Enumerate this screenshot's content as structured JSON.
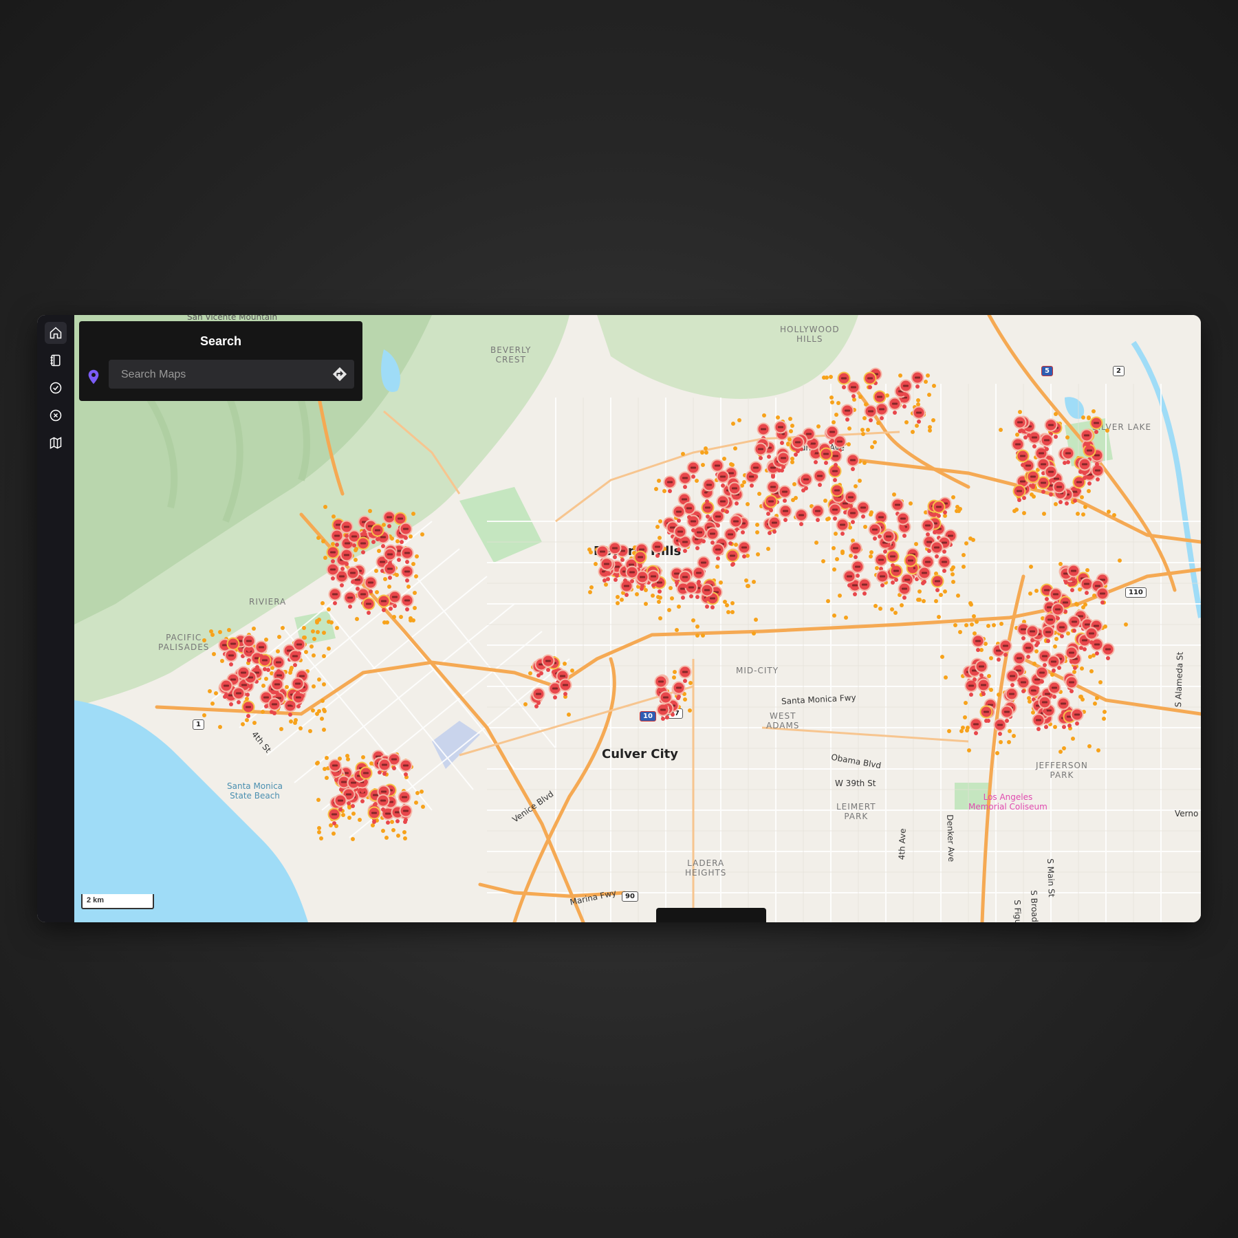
{
  "search": {
    "title": "Search",
    "placeholder": "Search Maps",
    "value": ""
  },
  "sidebar": {
    "items": [
      {
        "name": "home",
        "icon": "home-icon"
      },
      {
        "name": "notebook",
        "icon": "notebook-icon"
      },
      {
        "name": "check",
        "icon": "check-circle-icon"
      },
      {
        "name": "close",
        "icon": "x-circle-icon"
      },
      {
        "name": "map",
        "icon": "map-icon"
      }
    ]
  },
  "map": {
    "cities": [
      "Beverly Hills",
      "Culver City"
    ],
    "neighborhoods": [
      "BEVERLY CREST",
      "HOLLYWOOD HILLS",
      "SILVER LAKE",
      "RIVIERA",
      "PACIFIC PALISADES",
      "MID-CITY",
      "WEST ADAMS",
      "JEFFERSON PARK",
      "LEIMERT PARK",
      "LADERA HEIGHTS"
    ],
    "neighborhood_lines": {
      "beverly_crest": [
        "BEVERLY",
        "CREST"
      ],
      "hollywood_hills": [
        "HOLLYWOOD",
        "HILLS"
      ],
      "pacific_palisades": [
        "PACIFIC",
        "PALISADES"
      ],
      "west_adams": [
        "WEST",
        "ADAMS"
      ],
      "jefferson_park": [
        "JEFFERSON",
        "PARK"
      ],
      "leimert_park": [
        "LEIMERT",
        "PARK"
      ],
      "ladera_heights": [
        "LADERA",
        "HEIGHTS"
      ]
    },
    "roads": [
      "Fountain Ave",
      "Santa Monica Fwy",
      "Obama Blvd",
      "W 39th St",
      "Venice Blvd",
      "Marina Fwy",
      "4th St",
      "S Alameda St",
      "S Figueroa St",
      "S Broadway",
      "S Main St",
      "Denker Ave",
      "4th Ave"
    ],
    "poi": [
      "Santa Monica",
      "State Beach",
      "Los Angeles",
      "Memorial Coliseum"
    ],
    "top_label": "San Vicente Mountain",
    "edge_labels": [
      "Verno"
    ],
    "shields": [
      "1",
      "10",
      "187",
      "90",
      "110",
      "5",
      "2"
    ],
    "scale": "2 km"
  },
  "colors": {
    "marker": "#e8474b",
    "dot": "#f7a21b",
    "water": "#9fdcf7",
    "park": "#c5e6c0",
    "freeway": "#f5a953"
  }
}
